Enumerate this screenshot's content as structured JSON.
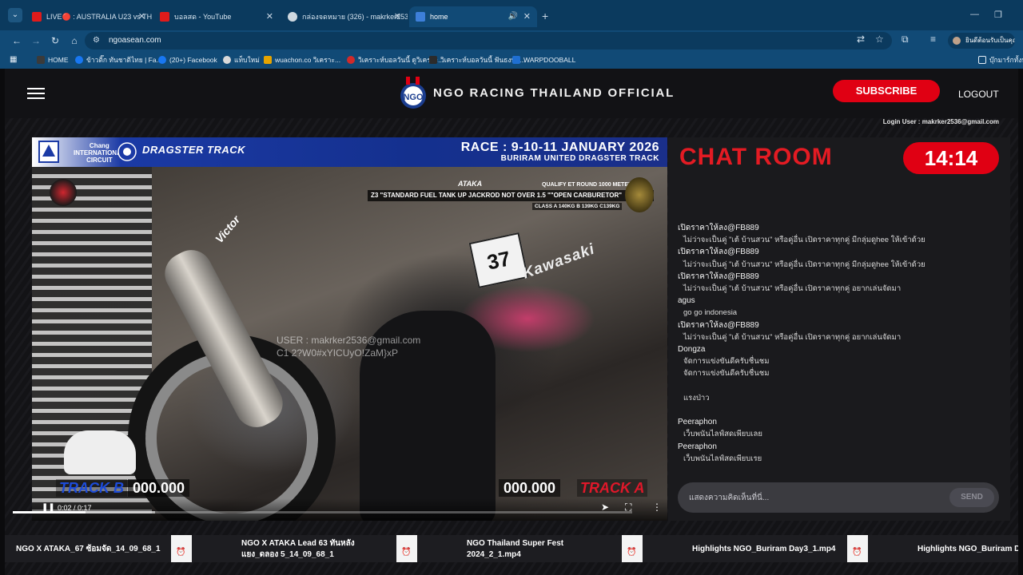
{
  "browser": {
    "tabs": [
      {
        "label": "LIVE🔴 : AUSTRALIA U23 vs TH…",
        "icon": "youtube-icon"
      },
      {
        "label": "บอลสด - YouTube",
        "icon": "youtube-icon"
      },
      {
        "label": "กล่องจดหมาย (326) - makrker253…",
        "icon": "mail-icon"
      },
      {
        "label": "home",
        "icon": "site-icon",
        "active": true
      }
    ],
    "new_tab": "+",
    "url": "ngoasean.com",
    "profile_label": "ยินดีต้อนรับเป็นคุณ",
    "bookmarks": [
      {
        "label": "HOME"
      },
      {
        "label": "ข้าวติ๊ก ทันชาติไทย | Fa..."
      },
      {
        "label": "(20+) Facebook"
      },
      {
        "label": "แท็บใหม่"
      },
      {
        "label": "wuachon.co วิเคราะ..."
      },
      {
        "label": "วิเคราะห์บอลวันนี้ ดูวิเคราะ..."
      },
      {
        "label": "วิเคราะห์บอลวันนี้ ฟันธงบอ..."
      },
      {
        "label": "WARPDOOBALL"
      }
    ],
    "bookmarks_folder": "บุ๊กมาร์กทั้งหมด"
  },
  "site": {
    "title": "NGO RACING THAILAND OFFICIAL",
    "subscribe_label": "SUBSCRIBE",
    "logout_label": "LOGOUT",
    "login_user": "Login User : makrker2536@gmail.com"
  },
  "video": {
    "banner_chang": "Chang\nINTERNATIONAL\nCIRCUIT",
    "banner_dragster": "DRAGSTER TRACK",
    "banner_race": "RACE : 9-10-11 JANUARY 2026",
    "banner_venue": "BURIRAM UNITED DRAGSTER TRACK",
    "overlay_ataka": "ATAKA",
    "overlay_qualify": "QUALIFY ET ROUND     1000 METERS",
    "overlay_class_line": "Z3 \"STANDARD FUEL TANK UP JACKROD NOT OVER 1.5 \"\"OPEN CARBURETOR\"",
    "overlay_class": "CLASS A 140KG B 139KG C139KG",
    "watermark_user": "USER : makrker2536@gmail.com",
    "watermark_code": "C1 2?W0#xYICUyO!ZaM}xP",
    "scene_plate": "37",
    "scene_brand_right": "Kawasaki",
    "scene_brand_left": "Victor",
    "track_b_label": "TRACK B",
    "track_b_time": "000.000",
    "track_a_time": "000.000",
    "track_a_label": "TRACK A",
    "time_display": "0:02 / 0:17",
    "progress_fraction": 0.118,
    "buffer_fraction": 0.23
  },
  "chat": {
    "title": "CHAT ROOM",
    "clock": "14:14",
    "messages": [
      {
        "type": "user",
        "text": "เปิดราคาให้ลง@FB889"
      },
      {
        "type": "text",
        "text": "ไม่ว่าจะเป็นคู่ \"เต้ บ้านสวน\" หรือคู่อื่น เปิดราคาทุกคู่ มีกลุ่มดูhee ให้เข้าด้วย"
      },
      {
        "type": "user",
        "text": "เปิดราคาให้ลง@FB889"
      },
      {
        "type": "text",
        "text": "ไม่ว่าจะเป็นคู่ \"เต้ บ้านสวน\" หรือคู่อื่น เปิดราคาทุกคู่ มีกลุ่มดูhee ให้เข้าด้วย"
      },
      {
        "type": "user",
        "text": "เปิดราคาให้ลง@FB889"
      },
      {
        "type": "text",
        "text": "ไม่ว่าจะเป็นคู่ \"เต้ บ้านสวน\" หรือคู่อื่น เปิดราคาทุกคู่ อยากเล่นจัดมา"
      },
      {
        "type": "user",
        "text": "agus"
      },
      {
        "type": "text",
        "text": "go go indonesia"
      },
      {
        "type": "user",
        "text": "เปิดราคาให้ลง@FB889"
      },
      {
        "type": "text",
        "text": "ไม่ว่าจะเป็นคู่ \"เต้ บ้านสวน\" หรือคู่อื่น เปิดราคาทุกคู่ อยากเล่นจัดมา"
      },
      {
        "type": "user",
        "text": "Dongza"
      },
      {
        "type": "text",
        "text": "จัดการแข่งขันดีครับชื่นชม"
      },
      {
        "type": "text",
        "text": "จัดการแข่งขันดีครับชื่นชม"
      },
      {
        "type": "blank",
        "text": ""
      },
      {
        "type": "text",
        "text": "แรงป่าว"
      },
      {
        "type": "blank",
        "text": ""
      },
      {
        "type": "user",
        "text": "Peeraphon"
      },
      {
        "type": "text",
        "text": "เว็บพนันไลฟ์สดเพียบเลย"
      },
      {
        "type": "user",
        "text": "Peeraphon"
      },
      {
        "type": "text",
        "text": "เว็บพนันไลฟ์สดเพียบเรย"
      }
    ],
    "input_placeholder": "แสดงความคิดเห็นที่นี่...",
    "send_label": "SEND"
  },
  "strip": {
    "items": [
      {
        "line1": "NGO X ATAKA_67 ซ้อมจัด_14_09_68_1",
        "line2": ""
      },
      {
        "line1": "NGO X ATAKA Lead 63 ทันหลัง",
        "line2": "แยง_ดลอง 5_14_09_68_1"
      },
      {
        "line1": "NGO Thailand Super Fest",
        "line2": "2024_2_1.mp4"
      },
      {
        "line1": "Highlights NGO_Buriram Day3_1.mp4",
        "line2": ""
      },
      {
        "line1": "Highlights NGO_Buriram Da",
        "line2": ""
      }
    ]
  },
  "colors": {
    "brand_red": "#e00013",
    "chat_title_red": "#e31b23",
    "chrome_blue": "#114a76"
  }
}
